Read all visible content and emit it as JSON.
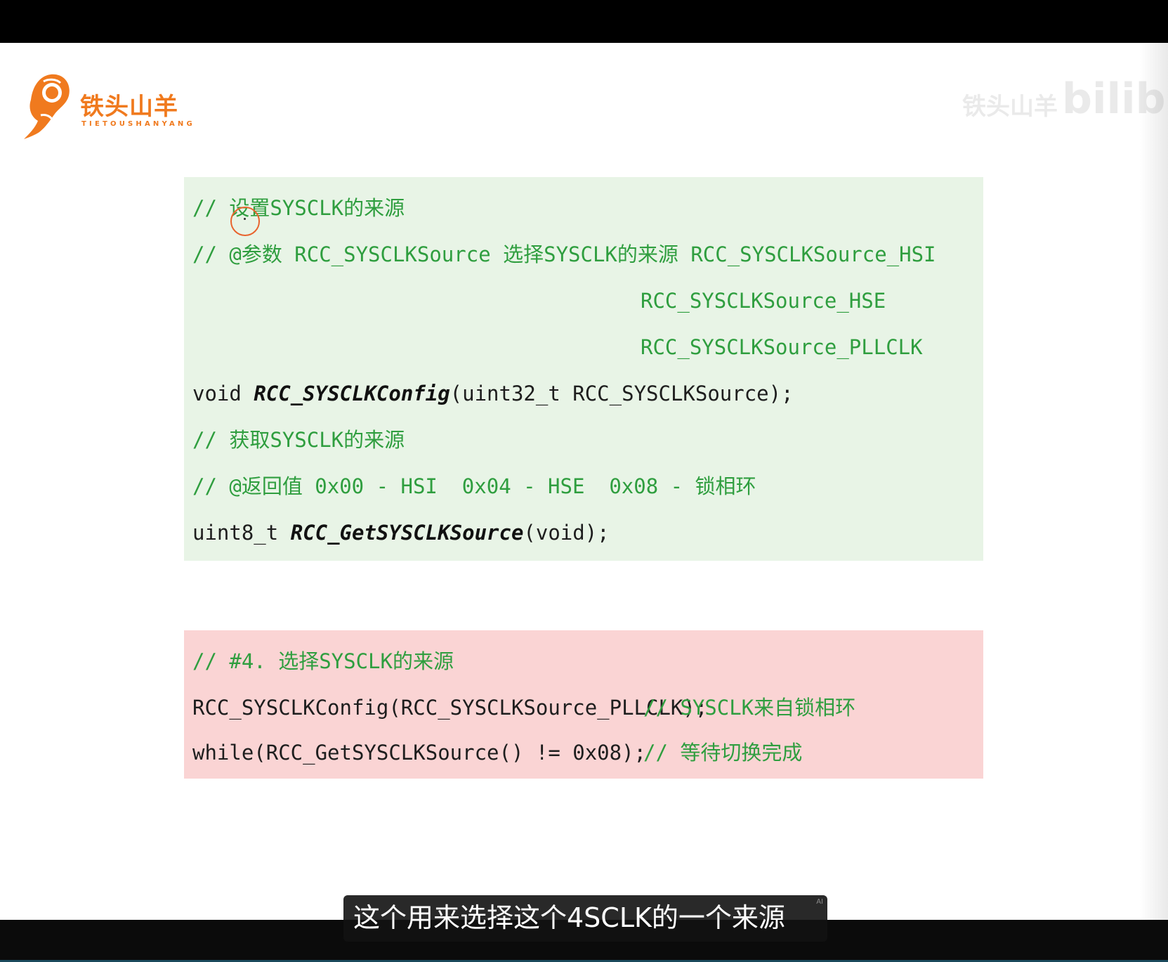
{
  "logo": {
    "name_cn": "铁头山羊",
    "name_en": "TIETOUSHANYANG"
  },
  "watermark": {
    "name": "铁头山羊",
    "site": "bilibili"
  },
  "green_box": {
    "lines": [
      {
        "comment": "// 设置SYSCLK的来源"
      },
      {
        "comment": "// @参数 RCC_SYSCLKSource 选择SYSCLK的来源 RCC_SYSCLKSource_HSI"
      },
      {
        "comment": "RCC_SYSCLKSource_HSE"
      },
      {
        "comment": "RCC_SYSCLKSource_PLLCLK"
      },
      {
        "prefix": "void ",
        "fn": "RCC_SYSCLKConfig",
        "suffix": "(uint32_t RCC_SYSCLKSource);"
      },
      {
        "comment": "// 获取SYSCLK的来源"
      },
      {
        "comment": "// @返回值 0x00 - HSI  0x04 - HSE  0x08 - 锁相环"
      },
      {
        "prefix": "uint8_t ",
        "fn": "RCC_GetSYSCLKSource",
        "suffix": "(void);"
      }
    ]
  },
  "red_box": {
    "lines": [
      {
        "comment": "// #4. 选择SYSCLK的来源"
      },
      {
        "code": "RCC_SYSCLKConfig(RCC_SYSCLKSource_PLLCLK);",
        "comment": "// SYSCLK来自锁相环"
      },
      {
        "code": "while(RCC_GetSYSCLKSource() != 0x08);",
        "comment": "// 等待切换完成"
      }
    ]
  },
  "subtitle": {
    "text": "这个用来选择这个4SCLK的一个来源",
    "badge": "AI"
  },
  "colors": {
    "comment": "#2f9e3f",
    "green_box_bg": "#e8f4e6",
    "red_box_bg": "#fad4d4",
    "logo_orange": "#f07a1e"
  }
}
